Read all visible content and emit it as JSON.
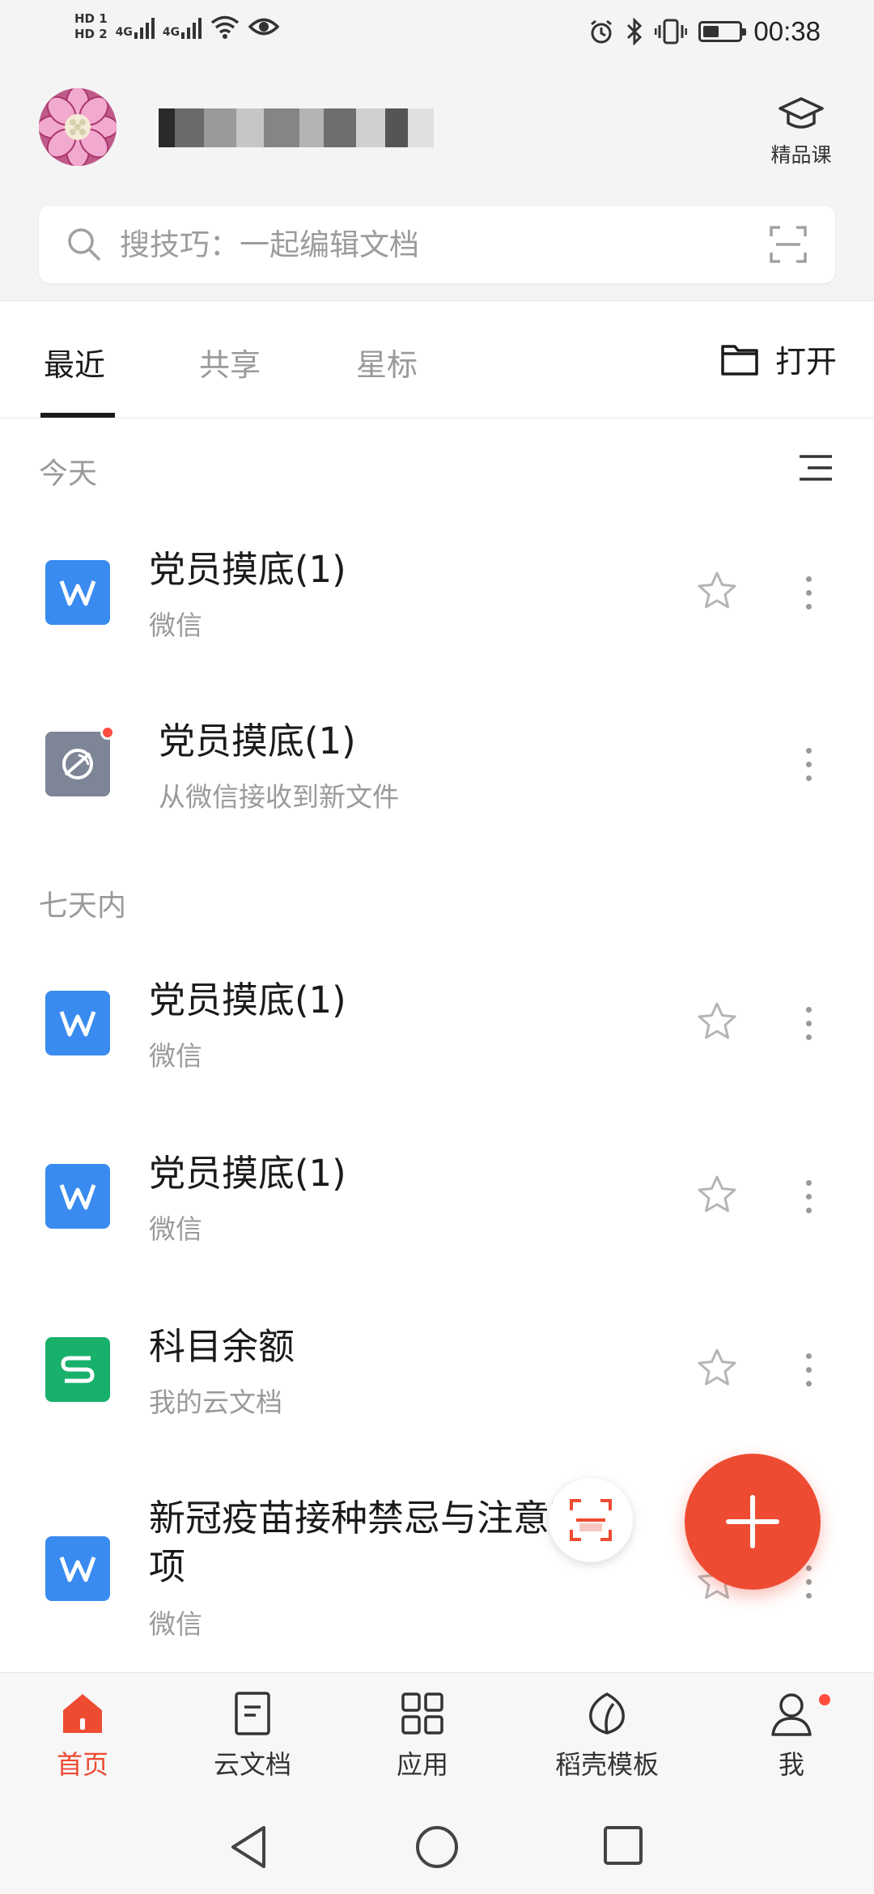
{
  "status_bar": {
    "sim1": "HD 1",
    "sim2": "HD 2",
    "net1": "4G",
    "net2": "4G",
    "time": "00:38",
    "battery_level": 0.45
  },
  "header": {
    "course_label": "精品课",
    "search_placeholder": "搜技巧：一起编辑文档"
  },
  "tabs": {
    "recent": "最近",
    "shared": "共享",
    "starred": "星标",
    "open": "打开"
  },
  "sections": {
    "today": "今天",
    "week": "七天内"
  },
  "files": [
    {
      "title": "党员摸底(1)",
      "subtitle": "微信",
      "icon": "doc-icon"
    },
    {
      "title": "党员摸底(1)",
      "subtitle": "从微信接收到新文件",
      "icon": "notice-icon"
    },
    {
      "title": "党员摸底(1)",
      "subtitle": "微信",
      "icon": "doc-icon"
    },
    {
      "title": "党员摸底(1)",
      "subtitle": "微信",
      "icon": "doc-icon"
    },
    {
      "title": "科目余额",
      "subtitle": "我的云文档",
      "icon": "sheet-icon"
    },
    {
      "title_line1": "新冠疫苗接种禁忌与注意事",
      "title_line2": "项",
      "subtitle": "微信",
      "icon": "doc-icon"
    }
  ],
  "nav": {
    "home": "首页",
    "cloud": "云文档",
    "apps": "应用",
    "templates": "稻壳模板",
    "me": "我"
  },
  "colors": {
    "accent": "#ee4b33",
    "doc_blue": "#3a8bf0",
    "sheet_green": "#18b06b",
    "badge_red": "#ff4d3f"
  }
}
